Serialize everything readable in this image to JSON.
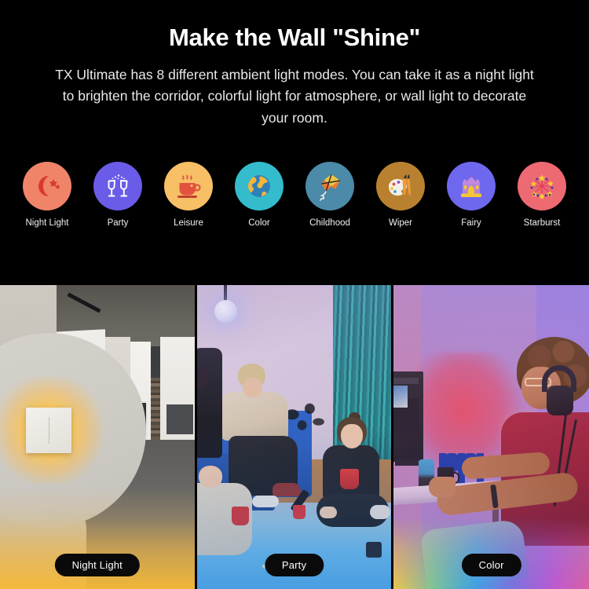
{
  "hero": {
    "title": "Make the Wall \"Shine\"",
    "subtitle": "TX Ultimate has 8 different ambient light modes. You can take it as a night light to brighten the corridor, colorful light for atmosphere, or wall light to decorate your room.",
    "background_color": "#000000",
    "text_color": "#ffffff"
  },
  "modes": {
    "count": 8,
    "items": [
      {
        "label": "Night Light",
        "icon": "crescent-moon-stars-icon",
        "circle_color": "#f08469",
        "icon_color": "#d8392f"
      },
      {
        "label": "Party",
        "icon": "champagne-glasses-icon",
        "circle_color": "#6a5ce8",
        "icon_color": "#ffffff"
      },
      {
        "label": "Leisure",
        "icon": "coffee-cup-steam-icon",
        "circle_color": "#f7bf66",
        "icon_color": "#e2523f"
      },
      {
        "label": "Color",
        "icon": "globe-icon",
        "circle_color": "#34bccd",
        "icon_color": "#2f7fb8"
      },
      {
        "label": "Childhood",
        "icon": "kite-icon",
        "circle_color": "#4b8aa8",
        "icon_color": "#f0a23c"
      },
      {
        "label": "Wiper",
        "icon": "paint-palette-brush-icon",
        "circle_color": "#b9812f",
        "icon_color": "#f4efe6"
      },
      {
        "label": "Fairy",
        "icon": "castle-crown-icon",
        "circle_color": "#6e68ef",
        "icon_color": "#f5c633"
      },
      {
        "label": "Starburst",
        "icon": "fireworks-stars-icon",
        "circle_color": "#ee6a72",
        "icon_color": "#f8cf33"
      }
    ]
  },
  "gallery": {
    "panels": [
      {
        "caption": "Night Light",
        "scene": "modern-corridor-with-square-wall-light",
        "accent_color": "#f7b934",
        "has_magnifier": true
      },
      {
        "caption": "Party",
        "scene": "friends-on-couch-with-red-cups",
        "accent_color": "#4da5e0",
        "has_magnifier": false
      },
      {
        "caption": "Color",
        "scene": "woman-with-headphones-at-rgb-lit-desk",
        "accent_color": "#c850d2",
        "has_magnifier": false
      }
    ],
    "caption_background": "#0a0a0a",
    "caption_text_color": "#ffffff"
  }
}
